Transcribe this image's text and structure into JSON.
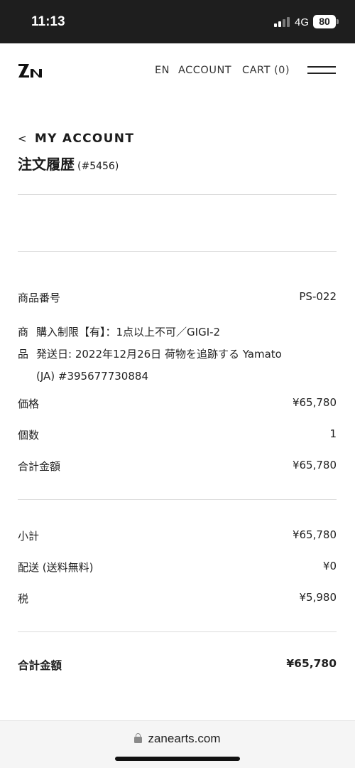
{
  "status_bar": {
    "time": "11:13",
    "network": "4G",
    "battery": "80"
  },
  "header": {
    "logo_icon": "zane-arts-logo",
    "nav": {
      "lang": "EN",
      "account": "ACCOUNT",
      "cart": "CART (0)"
    },
    "menu_icon": "hamburger-menu-icon"
  },
  "page": {
    "back_chevron": "<",
    "back_label": "MY ACCOUNT",
    "title": "注文履歴",
    "order_number": "(#5456)"
  },
  "item": {
    "product_code_label": "商品番号",
    "product_code_value": "PS-022",
    "product_lead_1": "商",
    "product_line_1": "購入制限【有】：1点以上不可／GIGI-2",
    "product_lead_2": "品",
    "product_line_2": "発送日: 2022年12月26日 荷物を追跡する Yamato",
    "product_line_3": "(JA) #395677730884",
    "price_label": "価格",
    "price_value": "¥65,780",
    "qty_label": "個数",
    "qty_value": "1",
    "line_total_label": "合計金額",
    "line_total_value": "¥65,780"
  },
  "summary": {
    "subtotal_label": "小計",
    "subtotal_value": "¥65,780",
    "shipping_label": "配送 (送料無料)",
    "shipping_value": "¥0",
    "tax_label": "税",
    "tax_value": "¥5,980",
    "total_label": "合計金額",
    "total_value": "¥65,780"
  },
  "browser": {
    "url": "zanearts.com"
  }
}
